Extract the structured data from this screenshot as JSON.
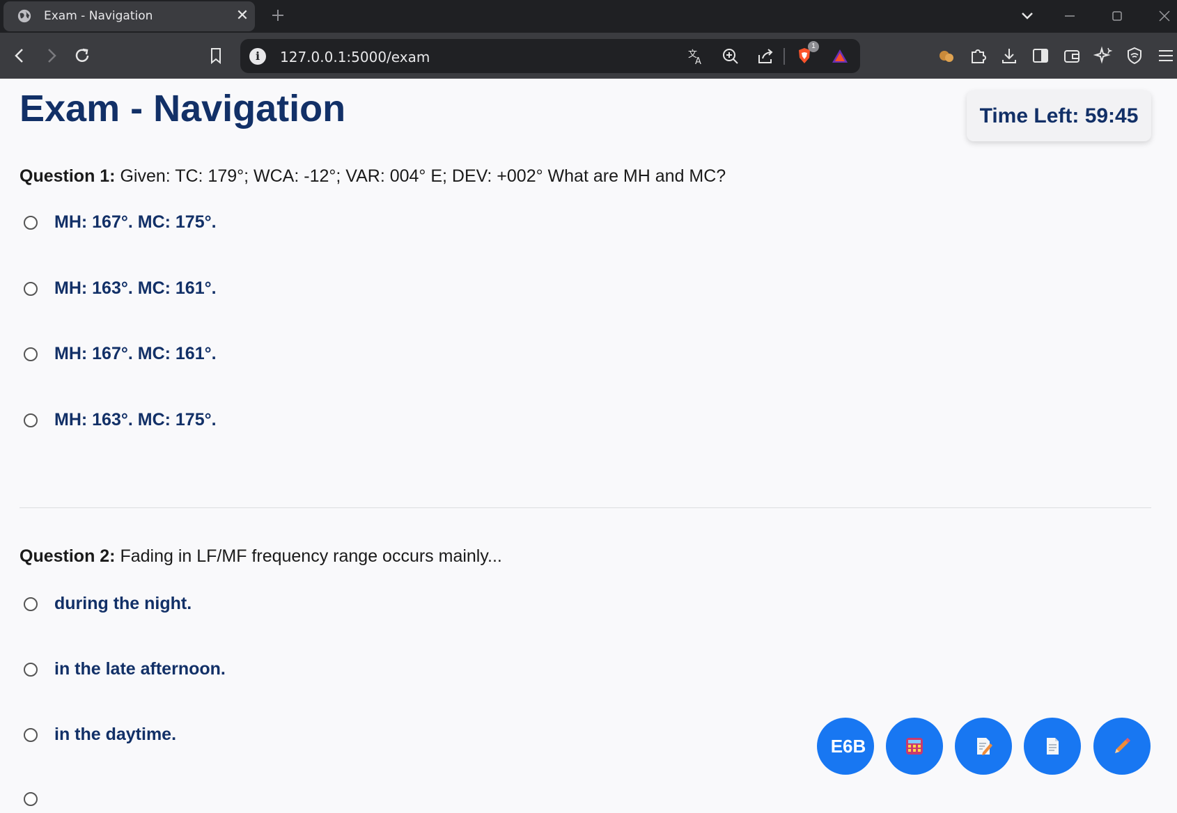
{
  "browser": {
    "tab_title": "Exam - Navigation",
    "url": "127.0.0.1:5000/exam",
    "shield_badge": "1"
  },
  "page": {
    "title": "Exam - Navigation",
    "timer_label": "Time Left: 59:45"
  },
  "questions": [
    {
      "number": "Question 1:",
      "text": "Given: TC: 179°; WCA: -12°; VAR: 004° E; DEV: +002° What are MH and MC?",
      "options": [
        "MH: 167°. MC: 175°.",
        "MH: 163°. MC: 161°.",
        "MH: 167°. MC: 161°.",
        "MH: 163°. MC: 175°."
      ]
    },
    {
      "number": "Question 2:",
      "text": "Fading in LF/MF frequency range occurs mainly...",
      "options": [
        "during the night.",
        "in the late afternoon.",
        "in the daytime."
      ]
    }
  ],
  "tools": {
    "e6b_label": "E6B",
    "icons": [
      "calculator-icon",
      "notes-icon",
      "document-icon",
      "pencil-icon"
    ]
  },
  "colors": {
    "accent": "#1877f2",
    "heading": "#123067"
  }
}
